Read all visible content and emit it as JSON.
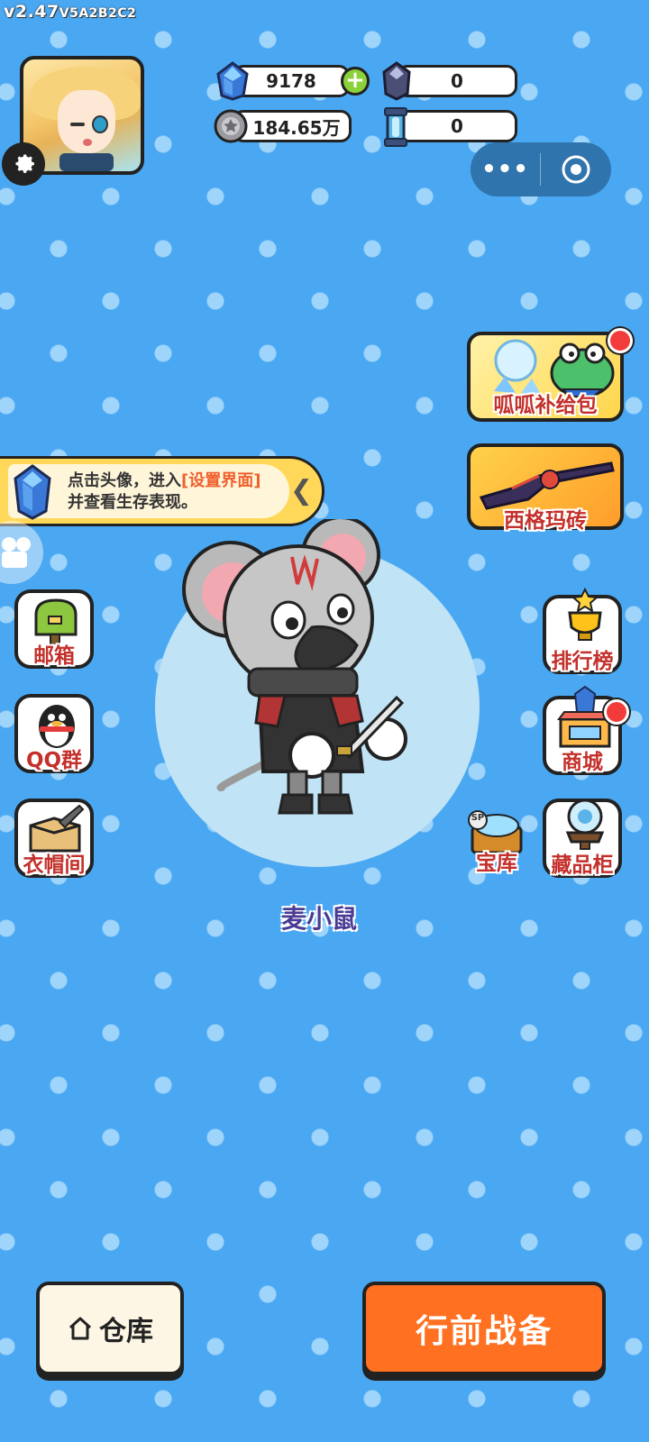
{
  "version": {
    "main": "v2.47",
    "sub": "V5A2B2C2"
  },
  "currencies": {
    "diamond": "9178",
    "dark_crystal": "0",
    "coin": "184.65万",
    "capsule": "0"
  },
  "tip": {
    "prefix": "点击头像，进入",
    "highlight": "[设置界面]",
    "suffix": "并查看生存表现。"
  },
  "features_right": {
    "supply_pack": "呱呱补给包",
    "sigma_brick": "西格玛砖",
    "leaderboard": "排行榜",
    "shop": "商城",
    "vault": "宝库",
    "vault_badge": "SP",
    "collection": "藏品柜"
  },
  "features_left": {
    "mailbox": "邮箱",
    "qq_group": "QQ群",
    "wardrobe": "衣帽间"
  },
  "character_name": "麦小鼠",
  "buttons": {
    "warehouse": "仓库",
    "prepare": "行前战备"
  },
  "colors": {
    "background": "#4aa8f2",
    "accent_orange": "#ff7020",
    "label_red": "#c4302b",
    "tip_yellow": "#ffd85a"
  }
}
